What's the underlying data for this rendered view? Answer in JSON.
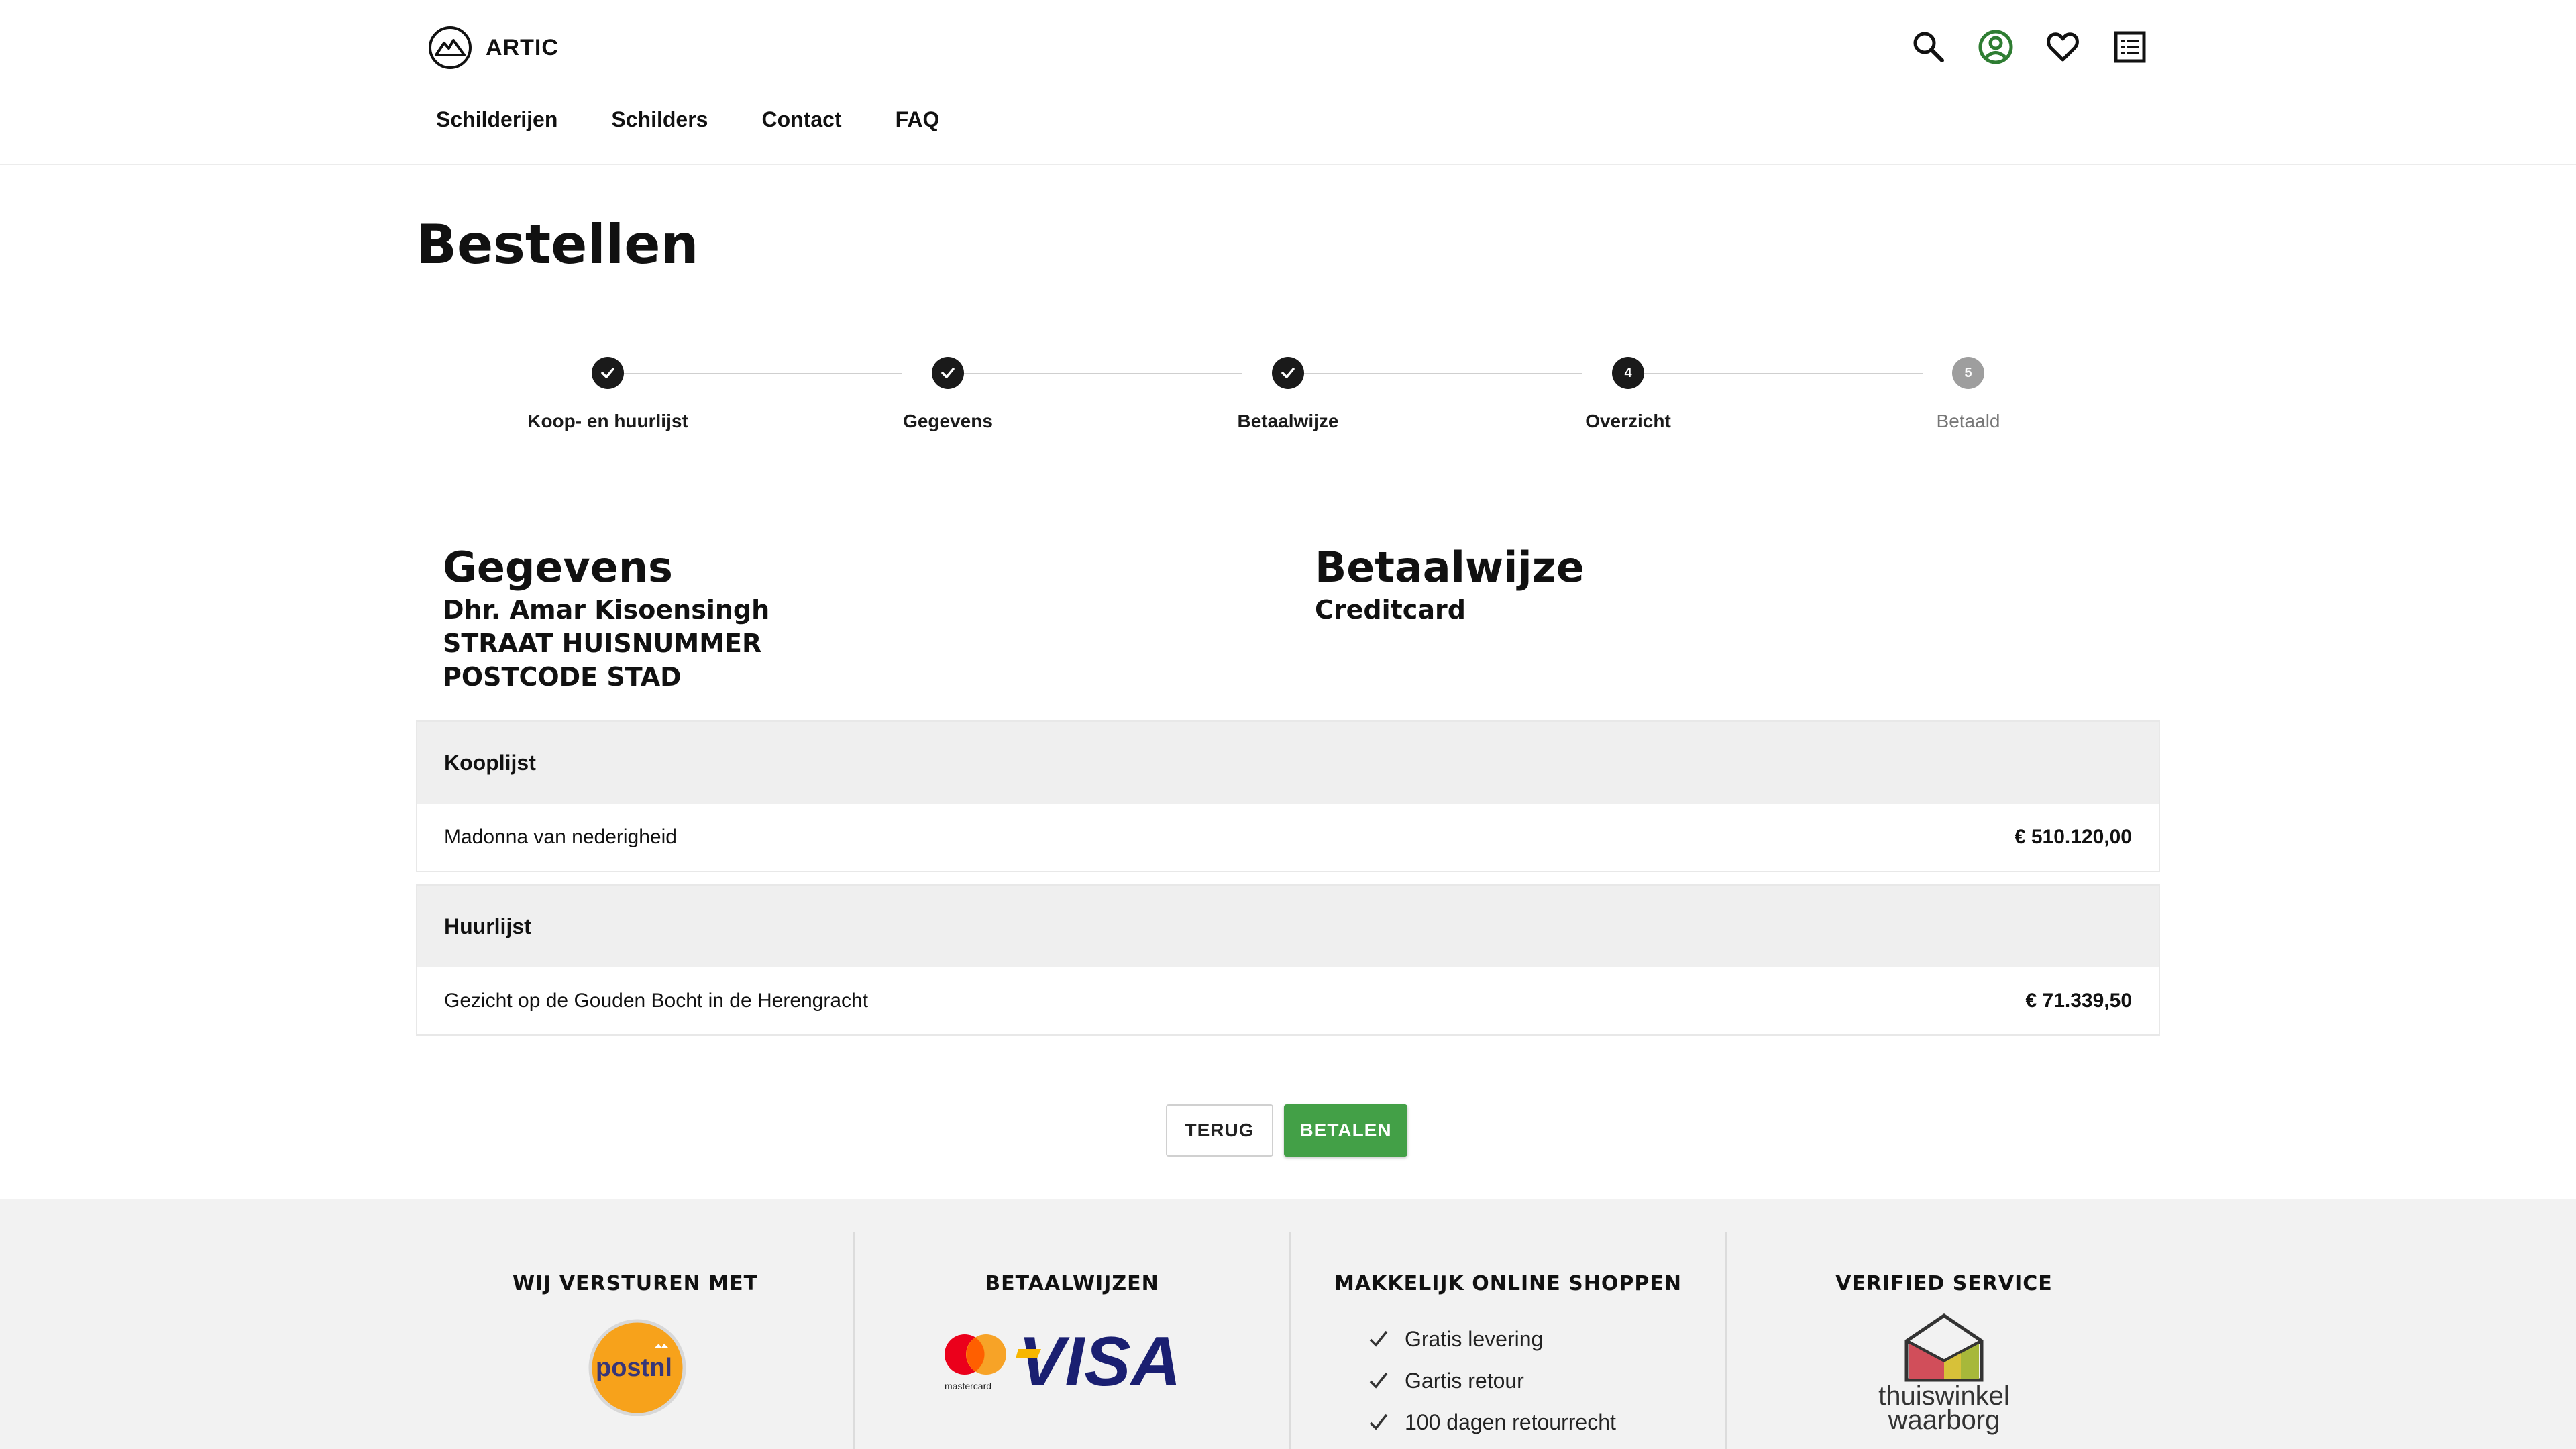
{
  "brand": {
    "name": "ARTIC"
  },
  "nav": {
    "items": [
      {
        "label": "Schilderijen"
      },
      {
        "label": "Schilders"
      },
      {
        "label": "Contact"
      },
      {
        "label": "FAQ"
      }
    ]
  },
  "toolbar": {
    "icons": [
      "search-icon",
      "account-icon",
      "heart-icon",
      "list-icon"
    ],
    "account_color": "#2e7d32"
  },
  "page": {
    "title": "Bestellen"
  },
  "stepper": {
    "steps": [
      {
        "label": "Koop- en huurlijst",
        "state": "done"
      },
      {
        "label": "Gegevens",
        "state": "done"
      },
      {
        "label": "Betaalwijze",
        "state": "done"
      },
      {
        "label": "Overzicht",
        "state": "current",
        "number": "4"
      },
      {
        "label": "Betaald",
        "state": "pending",
        "number": "5"
      }
    ]
  },
  "details": {
    "title": "Gegevens",
    "name": "Dhr. Amar Kisoensingh",
    "street": "STRAAT HUISNUMMER",
    "postcode": "POSTCODE STAD"
  },
  "payment": {
    "title": "Betaalwijze",
    "method": "Creditcard"
  },
  "koop": {
    "title": "Kooplijst",
    "items": [
      {
        "name": "Madonna van nederigheid",
        "price": "€ 510.120,00"
      }
    ]
  },
  "huur": {
    "title": "Huurlijst",
    "items": [
      {
        "name": "Gezicht op de Gouden Bocht in de Herengracht",
        "price": "€ 71.339,50"
      }
    ]
  },
  "actions": {
    "back": "TERUG",
    "pay": "BETALEN"
  },
  "colors": {
    "accent_green": "#43a047",
    "dark": "#1a1a1a",
    "pending": "#9e9e9e"
  },
  "footer": {
    "shipping": {
      "title": "WIJ VERSTUREN MET",
      "logo_text": "postnl"
    },
    "payments": {
      "title": "BETAALWIJZEN",
      "mastercard_text": "mastercard",
      "visa_text": "VISA"
    },
    "shopping": {
      "title": "MAKKELIJK ONLINE SHOPPEN",
      "points": [
        "Gratis levering",
        "Gartis retour",
        "100 dagen retourrecht"
      ]
    },
    "verified": {
      "title": "VERIFIED SERVICE",
      "logo_text_1": "thuiswinkel",
      "logo_text_2": "waarborg"
    }
  }
}
